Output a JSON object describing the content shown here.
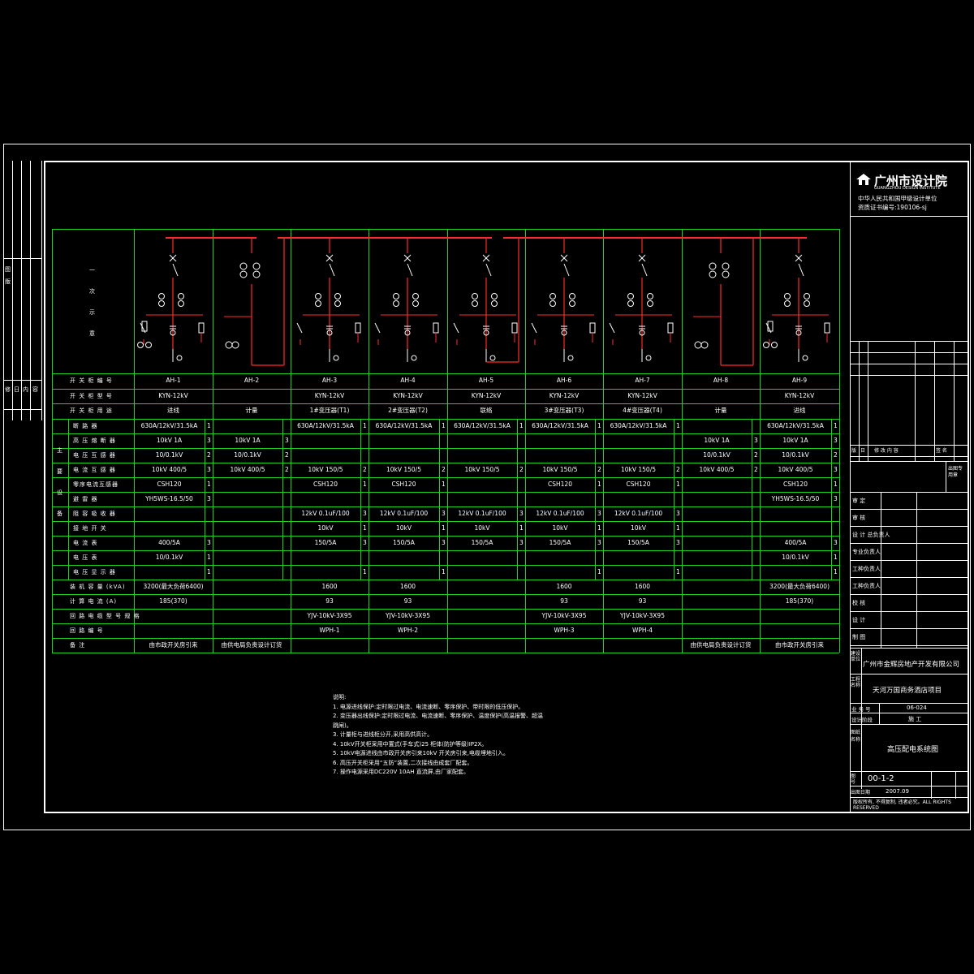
{
  "institute": {
    "name": "广州市设计院",
    "name_en": "GUANGZHOU DESIGN INSTITUTE",
    "line1": "中华人民共和国甲级设计单位",
    "line2": "资质证书编号:190106-sj"
  },
  "left_strip": {
    "labels": [
      "图",
      "版",
      "号",
      "修",
      "改",
      "日",
      "期",
      "内",
      "容"
    ]
  },
  "schematic_labels": [
    "一",
    "次",
    "示",
    "意"
  ],
  "panels": [
    {
      "id": "AH-1",
      "model": "KYN-12kV",
      "use": "进线",
      "breaker": "630A/12kV/31.5kA",
      "breaker_n": "1",
      "fuse": "10kV 1A",
      "fuse_n": "3",
      "vt": "10/0.1kV",
      "vt_n": "2",
      "ct": "10kV 400/5",
      "ct_n": "3",
      "sensor": "CSH120",
      "sensor_n": "1",
      "arrester": "YH5WS-16.5/50",
      "arrester_n": "3",
      "cap": "",
      "cap_n": "",
      "es": "",
      "es_n": "",
      "ammeter": "400/5A",
      "ammeter_n": "3",
      "vm": "10/0.1kV",
      "vm_n": "1",
      "ind": "",
      "ind_n": "1",
      "capacity": "3200(最大负荷6400)",
      "current": "185(370)",
      "cable": "",
      "circuit": "",
      "note": "由市政开关房引来"
    },
    {
      "id": "AH-2",
      "model": "",
      "use": "计量",
      "breaker": "",
      "breaker_n": "",
      "fuse": "10kV 1A",
      "fuse_n": "3",
      "vt": "10/0.1kV",
      "vt_n": "2",
      "ct": "10kV 400/5",
      "ct_n": "2",
      "sensor": "",
      "sensor_n": "",
      "arrester": "",
      "arrester_n": "",
      "cap": "",
      "cap_n": "",
      "es": "",
      "es_n": "",
      "ammeter": "",
      "ammeter_n": "",
      "vm": "",
      "vm_n": "",
      "ind": "",
      "ind_n": "",
      "capacity": "",
      "current": "",
      "cable": "",
      "circuit": "",
      "note": "由供电局负责设计订货"
    },
    {
      "id": "AH-3",
      "model": "KYN-12kV",
      "use": "1#变压器(T1)",
      "breaker": "630A/12kV/31.5kA",
      "breaker_n": "1",
      "fuse": "",
      "fuse_n": "",
      "vt": "",
      "vt_n": "",
      "ct": "10kV 150/5",
      "ct_n": "2",
      "sensor": "CSH120",
      "sensor_n": "1",
      "arrester": "",
      "arrester_n": "",
      "cap": "12kV 0.1uF/100",
      "cap_n": "3",
      "es": "10kV",
      "es_n": "1",
      "ammeter": "150/5A",
      "ammeter_n": "3",
      "vm": "",
      "vm_n": "",
      "ind": "",
      "ind_n": "1",
      "capacity": "1600",
      "current": "93",
      "cable": "YJV-10kV-3X95",
      "circuit": "WPH-1",
      "note": ""
    },
    {
      "id": "AH-4",
      "model": "KYN-12kV",
      "use": "2#变压器(T2)",
      "breaker": "630A/12kV/31.5kA",
      "breaker_n": "1",
      "fuse": "",
      "fuse_n": "",
      "vt": "",
      "vt_n": "",
      "ct": "10kV 150/5",
      "ct_n": "2",
      "sensor": "CSH120",
      "sensor_n": "1",
      "arrester": "",
      "arrester_n": "",
      "cap": "12kV 0.1uF/100",
      "cap_n": "3",
      "es": "10kV",
      "es_n": "1",
      "ammeter": "150/5A",
      "ammeter_n": "3",
      "vm": "",
      "vm_n": "",
      "ind": "",
      "ind_n": "1",
      "capacity": "1600",
      "current": "93",
      "cable": "YJV-10kV-3X95",
      "circuit": "WPH-2",
      "note": ""
    },
    {
      "id": "AH-5",
      "model": "KYN-12kV",
      "use": "联络",
      "breaker": "630A/12kV/31.5kA",
      "breaker_n": "1",
      "fuse": "",
      "fuse_n": "",
      "vt": "",
      "vt_n": "",
      "ct": "10kV 150/5",
      "ct_n": "2",
      "sensor": "",
      "sensor_n": "",
      "arrester": "",
      "arrester_n": "",
      "cap": "12kV 0.1uF/100",
      "cap_n": "3",
      "es": "10kV",
      "es_n": "1",
      "ammeter": "150/5A",
      "ammeter_n": "3",
      "vm": "",
      "vm_n": "",
      "ind": "",
      "ind_n": "",
      "capacity": "",
      "current": "",
      "cable": "",
      "circuit": "",
      "note": ""
    },
    {
      "id": "AH-6",
      "model": "KYN-12kV",
      "use": "3#变压器(T3)",
      "breaker": "630A/12kV/31.5kA",
      "breaker_n": "1",
      "fuse": "",
      "fuse_n": "",
      "vt": "",
      "vt_n": "",
      "ct": "10kV 150/5",
      "ct_n": "2",
      "sensor": "CSH120",
      "sensor_n": "1",
      "arrester": "",
      "arrester_n": "",
      "cap": "12kV 0.1uF/100",
      "cap_n": "3",
      "es": "10kV",
      "es_n": "1",
      "ammeter": "150/5A",
      "ammeter_n": "3",
      "vm": "",
      "vm_n": "",
      "ind": "",
      "ind_n": "1",
      "capacity": "1600",
      "current": "93",
      "cable": "YJV-10kV-3X95",
      "circuit": "WPH-3",
      "note": ""
    },
    {
      "id": "AH-7",
      "model": "KYN-12kV",
      "use": "4#变压器(T4)",
      "breaker": "630A/12kV/31.5kA",
      "breaker_n": "1",
      "fuse": "",
      "fuse_n": "",
      "vt": "",
      "vt_n": "",
      "ct": "10kV 150/5",
      "ct_n": "2",
      "sensor": "CSH120",
      "sensor_n": "1",
      "arrester": "",
      "arrester_n": "",
      "cap": "12kV 0.1uF/100",
      "cap_n": "3",
      "es": "10kV",
      "es_n": "1",
      "ammeter": "150/5A",
      "ammeter_n": "3",
      "vm": "",
      "vm_n": "",
      "ind": "",
      "ind_n": "1",
      "capacity": "1600",
      "current": "93",
      "cable": "YJV-10kV-3X95",
      "circuit": "WPH-4",
      "note": ""
    },
    {
      "id": "AH-8",
      "model": "",
      "use": "计量",
      "breaker": "",
      "breaker_n": "",
      "fuse": "10kV 1A",
      "fuse_n": "3",
      "vt": "10/0.1kV",
      "vt_n": "2",
      "ct": "10kV 400/5",
      "ct_n": "2",
      "sensor": "",
      "sensor_n": "",
      "arrester": "",
      "arrester_n": "",
      "cap": "",
      "cap_n": "",
      "es": "",
      "es_n": "",
      "ammeter": "",
      "ammeter_n": "",
      "vm": "",
      "vm_n": "",
      "ind": "",
      "ind_n": "",
      "capacity": "",
      "current": "",
      "cable": "",
      "circuit": "",
      "note": "由供电局负责设计订货"
    },
    {
      "id": "AH-9",
      "model": "KYN-12kV",
      "use": "进线",
      "breaker": "630A/12kV/31.5kA",
      "breaker_n": "1",
      "fuse": "10kV 1A",
      "fuse_n": "3",
      "vt": "10/0.1kV",
      "vt_n": "2",
      "ct": "10kV 400/5",
      "ct_n": "3",
      "sensor": "CSH120",
      "sensor_n": "1",
      "arrester": "YH5WS-16.5/50",
      "arrester_n": "3",
      "cap": "",
      "cap_n": "",
      "es": "",
      "es_n": "",
      "ammeter": "400/5A",
      "ammeter_n": "3",
      "vm": "10/0.1kV",
      "vm_n": "1",
      "ind": "",
      "ind_n": "1",
      "capacity": "3200(最大负荷6400)",
      "current": "185(370)",
      "cable": "",
      "circuit": "",
      "note": "由市政开关房引来"
    }
  ],
  "row_labels": {
    "panel_no": "开 关 柜 编 号",
    "model": "开 关 柜 型 号",
    "use": "开 关 柜 用 途",
    "main_equipment": "主 要 设 备",
    "breaker": "断 路 器",
    "fuse": "高 压 熔 断 器",
    "vt": "电 压 互 感 器",
    "ct": "电 流 互 感 器",
    "sensor": "零序电流互感器",
    "arrester": "避 雷 器",
    "cap": "阻 容 吸 收 器",
    "es": "接 地 开 关",
    "ammeter": "电 流 表",
    "vm": "电 压 表",
    "ind": "电 压 显 示 器",
    "capacity": "装 机 容 量 (kVA)",
    "current": "计 算 电 流 (A)",
    "cable": "回 路 电 缆 型 号 规 格",
    "circuit": "回 路 编 号",
    "note": "备 注"
  },
  "notes": {
    "title": "说明:",
    "lines": [
      "1. 电源进线保护:定时限过电流、电流速断、零序保护、带时限的低压保护。",
      "2. 变压器出线保护:定时限过电流、电流速断、零序保护、温度保护(高温报警、超温跳闸)。",
      "3. 计量柜与进线柜分开,采用高供高计。",
      "4. 10kV开关柜采用中置式(手车式)25 柜体(防护等级)IP2X。",
      "5. 10kV电源进线由市政开关房引来10kV 开关房引来,电缆埋地引入。",
      "6. 高压开关柜采用“五防”装置,二次接线由成套厂配套。",
      "7. 操作电源采用DC220V 10AH 直流屏,由厂家配套。"
    ]
  },
  "title_block": {
    "client_label": "建设单位",
    "client": "广州市金辉房地产开发有限公司",
    "project_label": "工程名称",
    "project": "天河万国商务酒店项目",
    "job_no_label": "业 务 号",
    "job_no": "06-024",
    "stage_label": "设计阶段",
    "stage": "施 工",
    "drawing_name_label": "图纸名称",
    "drawing_name": "高压配电系统图",
    "drawing_no_label": "图 号",
    "drawing_no": "00-1-2",
    "date_label": "出图日期",
    "date": "2007.09",
    "copyright": "版权所有, 不得复制, 违者必究。ALL RIGHTS RESERVED",
    "roles": [
      "审 定",
      "审 核",
      "设 计 总负责人",
      "专业负责人",
      "工种负责人",
      "工种负责人",
      "校 核",
      "设 计",
      "制 图"
    ],
    "rev_header": [
      "版",
      "日",
      "修 改 内 容",
      "签 名"
    ],
    "stamp": "出图专用章"
  },
  "colors": {
    "grid": "#1fd31f",
    "bus": "#ff2a2a",
    "symbol": "#ffffff",
    "bg": "#000000"
  }
}
